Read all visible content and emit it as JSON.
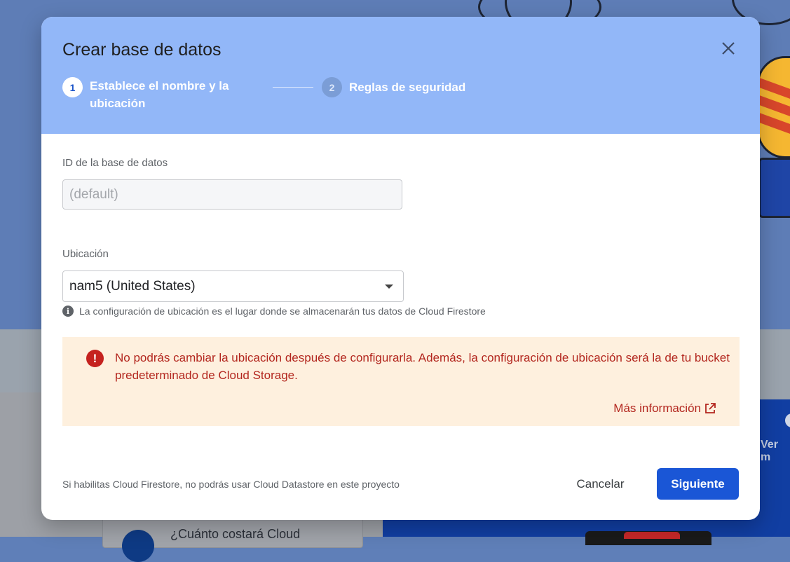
{
  "dialog": {
    "title": "Crear base de datos",
    "steps": [
      {
        "number": "1",
        "label": "Establece el nombre y la ubicación"
      },
      {
        "number": "2",
        "label": "Reglas de seguridad"
      }
    ]
  },
  "database_id": {
    "label": "ID de la base de datos",
    "placeholder": "(default)"
  },
  "location": {
    "label": "Ubicación",
    "value": "nam5 (United States)",
    "hint": "La configuración de ubicación es el lugar donde se almacenarán tus datos de Cloud Firestore"
  },
  "warning": {
    "text": "No podrás cambiar la ubicación después de configurarla. Además, la configuración de ubicación será la de tu bucket predeterminado de Cloud Storage.",
    "link": "Más información"
  },
  "footer": {
    "note": "Si habilitas Cloud Firestore, no podrás usar Cloud Datastore en este proyecto",
    "cancel": "Cancelar",
    "next": "Siguiente"
  },
  "background": {
    "card_text": "¿Cuánto costará Cloud",
    "ver": "Ver m"
  },
  "colors": {
    "header": "#92b7f8",
    "primary_button": "#1a56d6",
    "warning_bg": "#fef0de",
    "warning_text": "#b3261e"
  }
}
